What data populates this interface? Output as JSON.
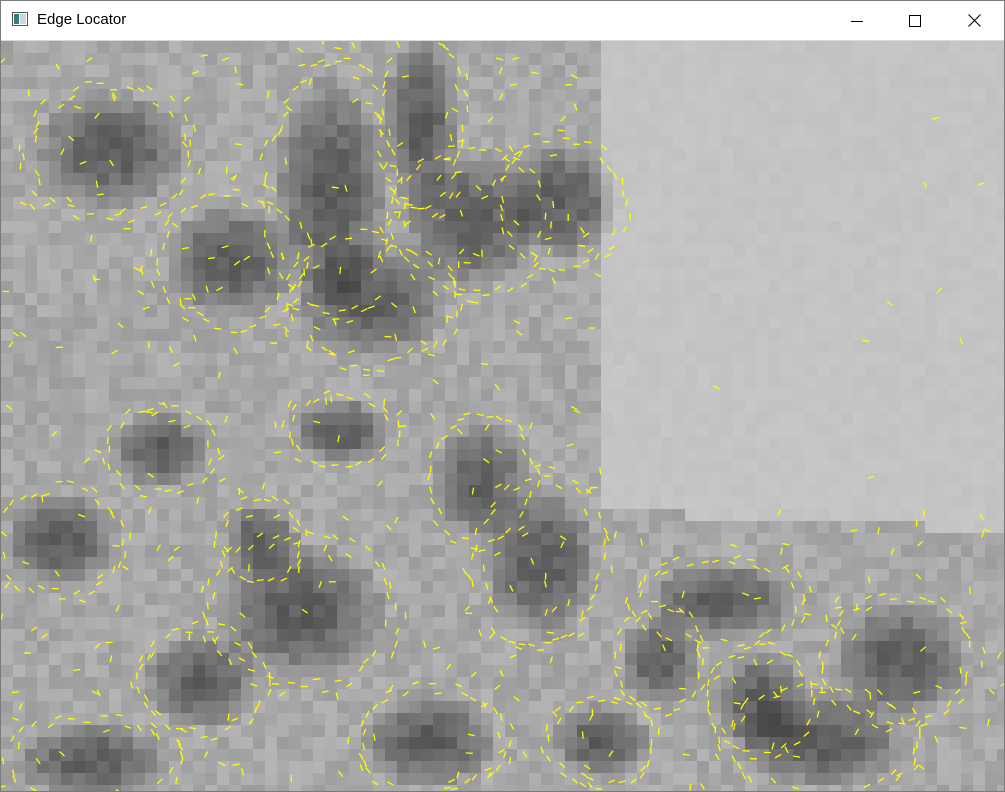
{
  "window": {
    "title": "Edge Locator",
    "icon": "app-window-icon",
    "controls": {
      "minimize_icon": "minimize-icon",
      "maximize_icon": "maximize-icon",
      "close_icon": "close-icon"
    }
  },
  "viewport": {
    "content": "grayscale-image-with-yellow-edge-markers",
    "edge_marker_color": "#ffff00",
    "background_light": "#c4c4c4",
    "background_dark": "#5a5a5a"
  }
}
